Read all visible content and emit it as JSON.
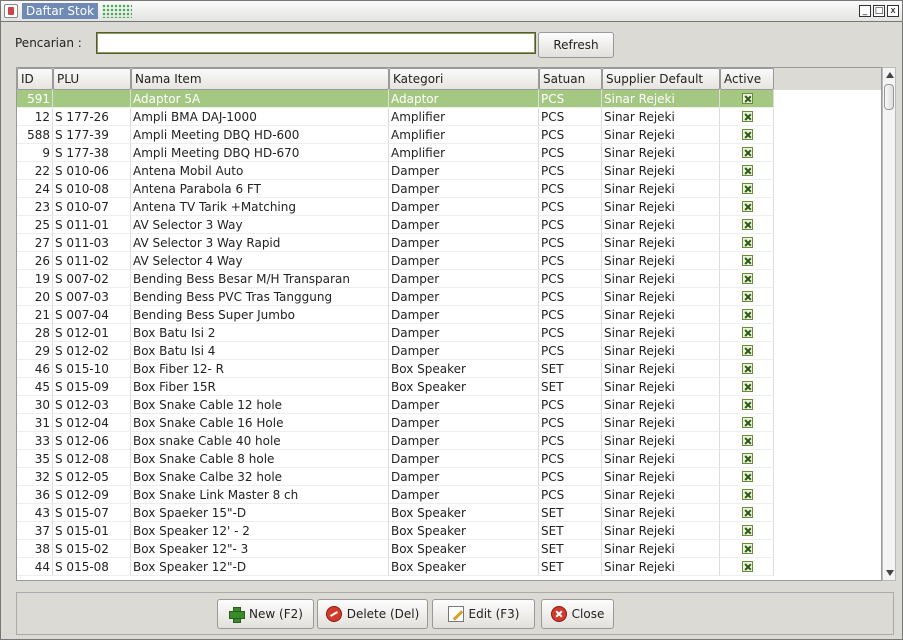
{
  "window": {
    "title": "Daftar Stok",
    "minimize": "_",
    "maximize": "□",
    "close": "x"
  },
  "search": {
    "label": "Pencarian :",
    "value": "",
    "placeholder": "",
    "refresh_label": "Refresh"
  },
  "table": {
    "columns": [
      "ID",
      "PLU",
      "Nama Item",
      "Kategori",
      "Satuan",
      "Supplier Default",
      "Active"
    ],
    "selected_index": 0,
    "rows": [
      {
        "id": "591",
        "plu": "",
        "name": "Adaptor 5A",
        "category": "Adaptor",
        "unit": "PCS",
        "supplier": "Sinar Rejeki",
        "active": true
      },
      {
        "id": "12",
        "plu": "S 177-26",
        "name": "Ampli BMA DAJ-1000",
        "category": "Amplifier",
        "unit": "PCS",
        "supplier": "Sinar Rejeki",
        "active": true
      },
      {
        "id": "588",
        "plu": "S 177-39",
        "name": "Ampli Meeting DBQ HD-600",
        "category": "Amplifier",
        "unit": "PCS",
        "supplier": "Sinar Rejeki",
        "active": true
      },
      {
        "id": "9",
        "plu": "S 177-38",
        "name": "Ampli Meeting DBQ HD-670",
        "category": "Amplifier",
        "unit": "PCS",
        "supplier": "Sinar Rejeki",
        "active": true
      },
      {
        "id": "22",
        "plu": "S 010-06",
        "name": "Antena Mobil Auto",
        "category": "Damper",
        "unit": "PCS",
        "supplier": "Sinar Rejeki",
        "active": true
      },
      {
        "id": "24",
        "plu": "S 010-08",
        "name": "Antena Parabola 6 FT",
        "category": "Damper",
        "unit": "PCS",
        "supplier": "Sinar Rejeki",
        "active": true
      },
      {
        "id": "23",
        "plu": "S 010-07",
        "name": "Antena TV Tarik +Matching",
        "category": "Damper",
        "unit": "PCS",
        "supplier": "Sinar Rejeki",
        "active": true
      },
      {
        "id": "25",
        "plu": "S 011-01",
        "name": "AV Selector 3 Way",
        "category": "Damper",
        "unit": "PCS",
        "supplier": "Sinar Rejeki",
        "active": true
      },
      {
        "id": "27",
        "plu": "S 011-03",
        "name": "AV Selector 3 Way Rapid",
        "category": "Damper",
        "unit": "PCS",
        "supplier": "Sinar Rejeki",
        "active": true
      },
      {
        "id": "26",
        "plu": "S 011-02",
        "name": "AV Selector 4 Way",
        "category": "Damper",
        "unit": "PCS",
        "supplier": "Sinar Rejeki",
        "active": true
      },
      {
        "id": "19",
        "plu": "S 007-02",
        "name": "Bending Bess Besar M/H Transparan",
        "category": "Damper",
        "unit": "PCS",
        "supplier": "Sinar Rejeki",
        "active": true
      },
      {
        "id": "20",
        "plu": "S 007-03",
        "name": "Bending Bess PVC Tras Tanggung",
        "category": "Damper",
        "unit": "PCS",
        "supplier": "Sinar Rejeki",
        "active": true
      },
      {
        "id": "21",
        "plu": "S 007-04",
        "name": "Bending Bess Super Jumbo",
        "category": "Damper",
        "unit": "PCS",
        "supplier": "Sinar Rejeki",
        "active": true
      },
      {
        "id": "28",
        "plu": "S 012-01",
        "name": "Box Batu Isi 2",
        "category": "Damper",
        "unit": "PCS",
        "supplier": "Sinar Rejeki",
        "active": true
      },
      {
        "id": "29",
        "plu": "S 012-02",
        "name": "Box Batu Isi 4",
        "category": "Damper",
        "unit": "PCS",
        "supplier": "Sinar Rejeki",
        "active": true
      },
      {
        "id": "46",
        "plu": "S 015-10",
        "name": "Box Fiber 12- R",
        "category": "Box Speaker",
        "unit": "SET",
        "supplier": "Sinar Rejeki",
        "active": true
      },
      {
        "id": "45",
        "plu": "S 015-09",
        "name": "Box Fiber 15R",
        "category": "Box Speaker",
        "unit": "SET",
        "supplier": "Sinar Rejeki",
        "active": true
      },
      {
        "id": "30",
        "plu": "S 012-03",
        "name": "Box Snake Cable 12 hole",
        "category": "Damper",
        "unit": "PCS",
        "supplier": "Sinar Rejeki",
        "active": true
      },
      {
        "id": "31",
        "plu": "S 012-04",
        "name": "Box Snake Cable 16 Hole",
        "category": "Damper",
        "unit": "PCS",
        "supplier": "Sinar Rejeki",
        "active": true
      },
      {
        "id": "33",
        "plu": "S 012-06",
        "name": "Box snake Cable 40 hole",
        "category": "Damper",
        "unit": "PCS",
        "supplier": "Sinar Rejeki",
        "active": true
      },
      {
        "id": "35",
        "plu": "S 012-08",
        "name": "Box Snake Cable 8 hole",
        "category": "Damper",
        "unit": "PCS",
        "supplier": "Sinar Rejeki",
        "active": true
      },
      {
        "id": "32",
        "plu": "S 012-05",
        "name": "Box Snake Calbe 32 hole",
        "category": "Damper",
        "unit": "PCS",
        "supplier": "Sinar Rejeki",
        "active": true
      },
      {
        "id": "36",
        "plu": "S 012-09",
        "name": "Box Snake Link Master 8 ch",
        "category": "Damper",
        "unit": "PCS",
        "supplier": "Sinar Rejeki",
        "active": true
      },
      {
        "id": "43",
        "plu": "S 015-07",
        "name": "Box Spaeker 15\"-D",
        "category": "Box Speaker",
        "unit": "SET",
        "supplier": "Sinar Rejeki",
        "active": true
      },
      {
        "id": "37",
        "plu": "S 015-01",
        "name": "Box Speaker 12' - 2",
        "category": "Box Speaker",
        "unit": "SET",
        "supplier": "Sinar Rejeki",
        "active": true
      },
      {
        "id": "38",
        "plu": "S 015-02",
        "name": "Box Speaker 12\"- 3",
        "category": "Box Speaker",
        "unit": "SET",
        "supplier": "Sinar Rejeki",
        "active": true
      },
      {
        "id": "44",
        "plu": "S 015-08",
        "name": "Box Speaker 12\"-D",
        "category": "Box Speaker",
        "unit": "SET",
        "supplier": "Sinar Rejeki",
        "active": true
      }
    ]
  },
  "footer": {
    "new_label": "New (F2)",
    "delete_label": "Delete (Del)",
    "edit_label": "Edit (F3)",
    "close_label": "Close"
  },
  "icons": {
    "new": "plus-icon",
    "delete": "delete-icon",
    "edit": "edit-icon",
    "close": "close-icon"
  },
  "colors": {
    "selection": "#a4c881",
    "titlebar_accent": "#6e8ab5"
  }
}
